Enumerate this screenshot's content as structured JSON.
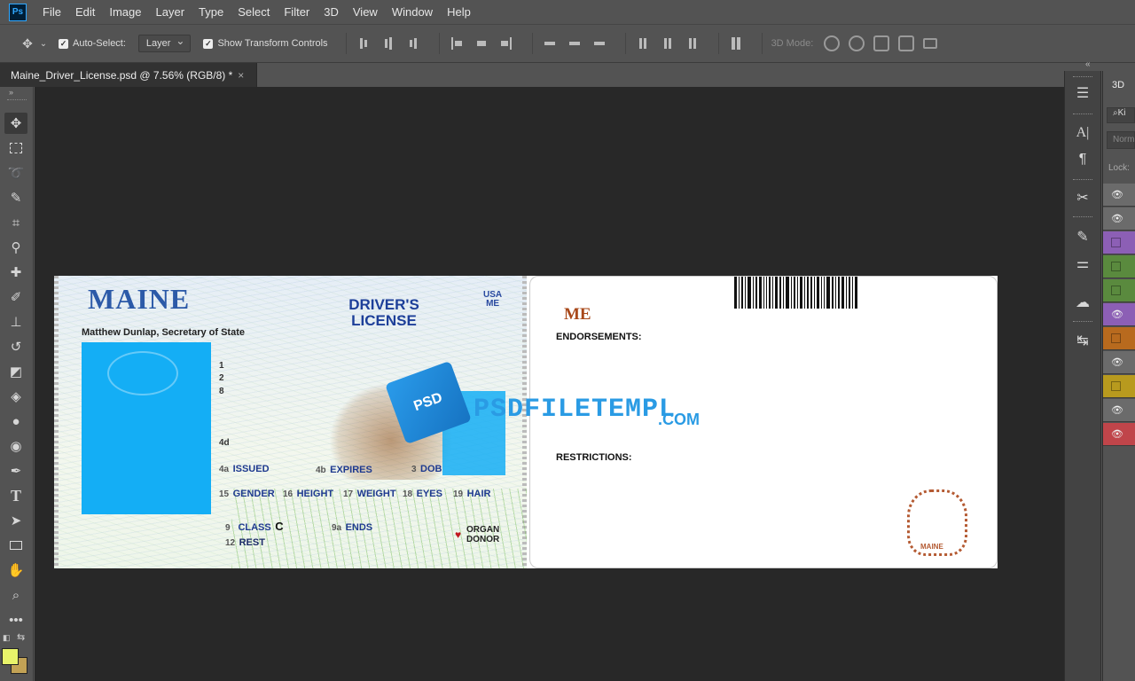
{
  "app": {
    "logo": "Ps",
    "menu": [
      "File",
      "Edit",
      "Image",
      "Layer",
      "Type",
      "Select",
      "Filter",
      "3D",
      "View",
      "Window",
      "Help"
    ]
  },
  "options": {
    "auto_select_label": "Auto-Select:",
    "auto_select_checked": true,
    "auto_select_target": "Layer",
    "show_transform_label": "Show Transform Controls",
    "show_transform_checked": true,
    "mode_3d_label": "3D Mode:"
  },
  "document": {
    "tab_title": "Maine_Driver_License.psd @ 7.56% (RGB/8) *",
    "close_glyph": "×"
  },
  "front": {
    "state": "MAINE",
    "doc_type_line1": "DRIVER'S",
    "doc_type_line2": "LICENSE",
    "country_line1": "USA",
    "country_line2": "ME",
    "secretary": "Matthew Dunlap, Secretary of State",
    "nums": [
      "1",
      "2",
      "8",
      "4d"
    ],
    "fields": {
      "issued_num": "4a",
      "issued": "ISSUED",
      "expires_num": "4b",
      "expires": "EXPIRES",
      "dob_num": "3",
      "dob": "DOB",
      "gender_num": "15",
      "gender": "GENDER",
      "height_num": "16",
      "height": "HEIGHT",
      "weight_num": "17",
      "weight": "WEIGHT",
      "eyes_num": "18",
      "eyes": "EYES",
      "hair_num": "19",
      "hair": "HAIR",
      "class_num": "9",
      "class": "CLASS",
      "class_value": "C",
      "ends_num": "9a",
      "ends": "ENDS",
      "rest_num": "12",
      "rest": "REST",
      "organ_line1": "ORGAN",
      "organ_line2": "DONOR"
    },
    "heart": "♥"
  },
  "back": {
    "code": "ME",
    "endorsements": "ENDORSEMENTS:",
    "restrictions": "RESTRICTIONS:",
    "seal_text": "MAINE"
  },
  "watermark": {
    "cube_text": "PSD",
    "text": "PSDFILETEMPL",
    "suffix": ".COM"
  },
  "right_panel": {
    "tab": "3D",
    "search": "Ki",
    "blend": "Norm",
    "lock": "Lock:",
    "layer_colors": [
      "#6b6b6b",
      "#6b6b6b",
      "#8c5fb5",
      "#5a8a3e",
      "#5a8a3e",
      "#8c5fb5",
      "#b86a1e",
      "#6b6b6b",
      "#b89a1e",
      "#6b6b6b",
      "#c0454a"
    ],
    "layer_eyes": [
      true,
      true,
      false,
      false,
      false,
      true,
      false,
      true,
      false,
      true,
      true
    ]
  },
  "colors": {
    "foreground": "#e8f36a",
    "background": "#c2a255"
  }
}
